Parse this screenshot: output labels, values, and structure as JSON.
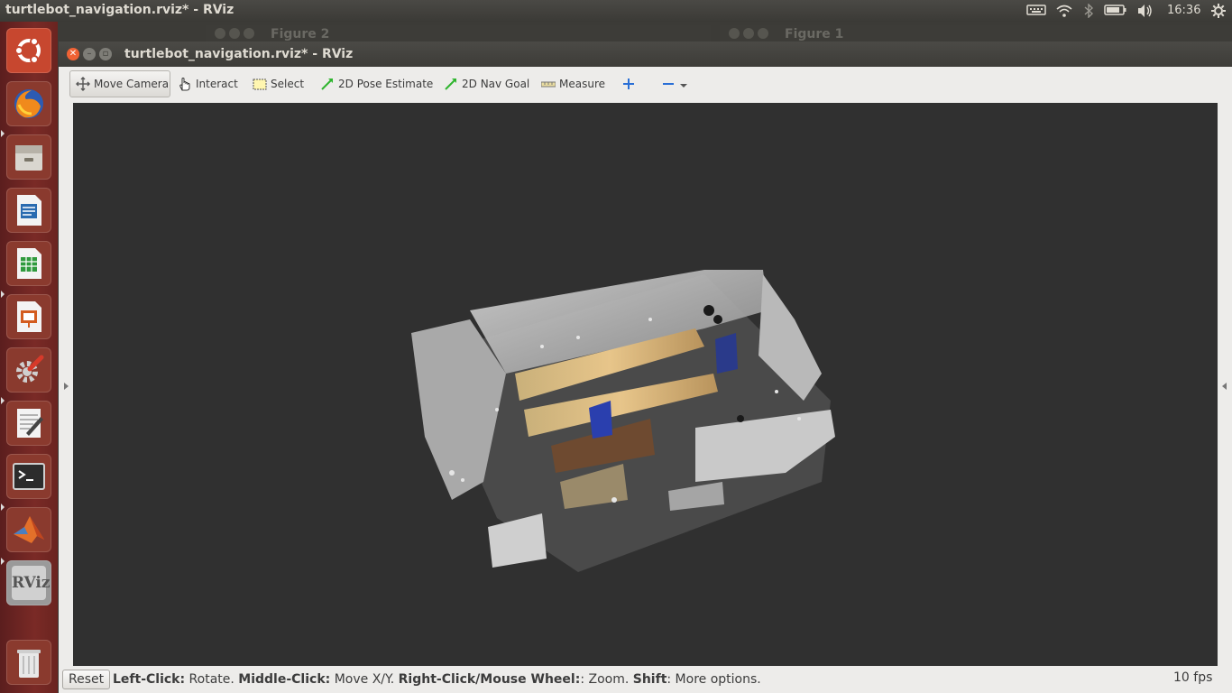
{
  "topbar": {
    "title": "turtlebot_navigation.rviz* - RViz",
    "clock": "16:36",
    "icons": [
      "keyboard-icon",
      "wifi-icon",
      "bluetooth-icon",
      "battery-icon",
      "volume-icon",
      "gear-icon"
    ]
  },
  "launcher": {
    "items": [
      "ubuntu-dash-icon",
      "firefox-icon",
      "files-icon",
      "writer-icon",
      "calc-icon",
      "impress-icon",
      "settings-icon",
      "text-editor-icon",
      "terminal-icon",
      "matlab-icon",
      "rviz-icon",
      "trash-icon"
    ],
    "rviz_label": "RViz"
  },
  "background_windows": [
    {
      "title": "Figure 2"
    },
    {
      "title": "Figure 1"
    }
  ],
  "window": {
    "title": "turtlebot_navigation.rviz* - RViz"
  },
  "toolbar": {
    "move_camera": "Move Camera",
    "interact": "Interact",
    "select": "Select",
    "pose_estimate": "2D Pose Estimate",
    "nav_goal": "2D Nav Goal",
    "measure": "Measure"
  },
  "status": {
    "reset": "Reset",
    "hint_leftclick_key": "Left-Click:",
    "hint_leftclick_val": " Rotate. ",
    "hint_middle_key": "Middle-Click:",
    "hint_middle_val": " Move X/Y. ",
    "hint_right_key": "Right-Click/Mouse Wheel:",
    "hint_right_val": ": Zoom. ",
    "hint_shift_key": "Shift",
    "hint_shift_val": ": More options.",
    "fps": "10 fps"
  },
  "colors": {
    "viewport_bg": "#303030",
    "launcher_bg": "#7a2a26",
    "panel_bg": "#3c3b37",
    "close_orange": "#f06234"
  }
}
